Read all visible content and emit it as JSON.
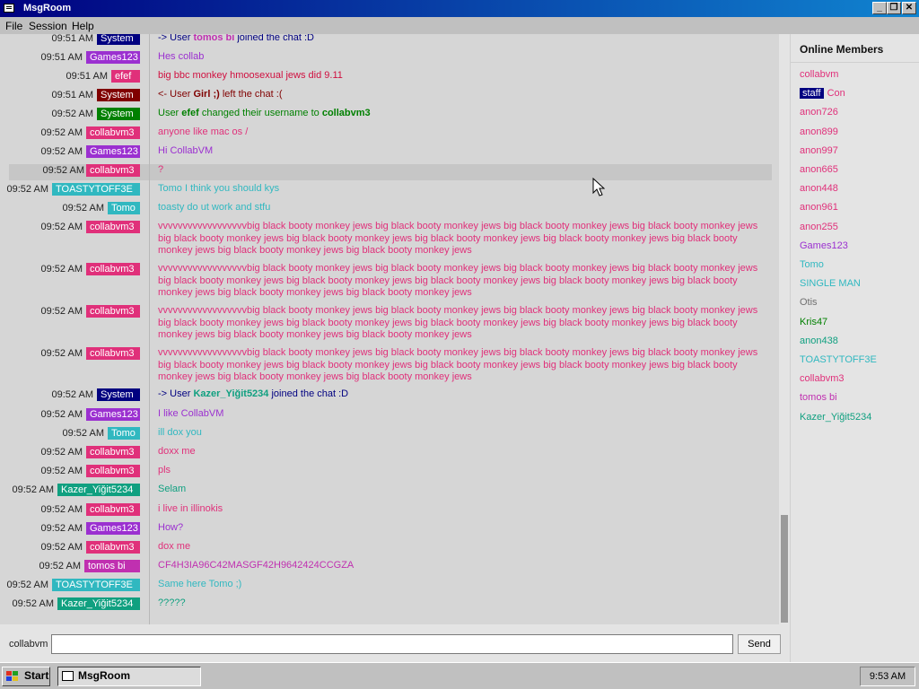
{
  "window": {
    "title": "MsgRoom"
  },
  "menu": [
    "File",
    "Session",
    "Help"
  ],
  "colors": {
    "system_blue": "#000080",
    "system_red": "#800000",
    "system_green": "#008000",
    "games": "#9b30d0",
    "collab": "#e0307a",
    "efef": "#e0307a",
    "toasty": "#30b8c0",
    "tomo": "#30b8c0",
    "kazer": "#10a080",
    "tomos": "#c030b0"
  },
  "messages": [
    {
      "time": "09:51 AM",
      "user": "System",
      "ucolor": "#000080",
      "tcolor": "#000080",
      "pre": "-> User ",
      "bold": "tomos bi",
      "post": " joined the chat :D"
    },
    {
      "time": "09:51 AM",
      "user": "Games123",
      "ucolor": "#9b30d0",
      "tcolor": "#9b30d0",
      "pre": "Hes collab",
      "bold": "",
      "post": ""
    },
    {
      "time": "09:51 AM",
      "user": "efef",
      "ucolor": "#e0307a",
      "tcolor": "#d01040",
      "pre": "big bbc monkey hmoosexual jews did 9.11",
      "bold": "",
      "post": ""
    },
    {
      "time": "09:51 AM",
      "user": "System",
      "ucolor": "#800000",
      "tcolor": "#800000",
      "pre": "<- User ",
      "bold": "Girl ;)",
      "post": " left the chat :("
    },
    {
      "time": "09:52 AM",
      "user": "System",
      "ucolor": "#008000",
      "tcolor": "#008000",
      "pre": "User ",
      "bold": "efef",
      "post": " changed their username to ",
      "bold2": "collabvm3"
    },
    {
      "time": "09:52 AM",
      "user": "collabvm3",
      "ucolor": "#e0307a",
      "tcolor": "#e0307a",
      "pre": "anyone like mac os /",
      "bold": "",
      "post": ""
    },
    {
      "time": "09:52 AM",
      "user": "Games123",
      "ucolor": "#9b30d0",
      "tcolor": "#9b30d0",
      "pre": "Hi CollabVM",
      "bold": "",
      "post": ""
    },
    {
      "time": "09:52 AM",
      "user": "collabvm3",
      "ucolor": "#e0307a",
      "tcolor": "#e0307a",
      "pre": "?",
      "bold": "",
      "post": "",
      "hl": true
    },
    {
      "time": "09:52 AM",
      "user": "TOASTYTOFF3E",
      "ucolor": "#30b8c0",
      "tcolor": "#30b8c0",
      "pre": "Tomo I think you should kys",
      "bold": "",
      "post": ""
    },
    {
      "time": "09:52 AM",
      "user": "Tomo",
      "ucolor": "#30b8c0",
      "tcolor": "#30b8c0",
      "pre": "toasty do ut work and stfu",
      "bold": "",
      "post": ""
    },
    {
      "time": "09:52 AM",
      "user": "collabvm3",
      "ucolor": "#e0307a",
      "tcolor": "#e0307a",
      "pre": "vvvvvvvvvvvvvvvvvvbig black booty monkey jews big black booty monkey jews big black booty monkey jews big black booty monkey jews big black booty monkey jews big black booty monkey jews big black booty monkey jews big black booty monkey jews big black booty monkey jews big black booty monkey jews big black booty monkey jews",
      "bold": "",
      "post": ""
    },
    {
      "time": "09:52 AM",
      "user": "collabvm3",
      "ucolor": "#e0307a",
      "tcolor": "#e0307a",
      "pre": "vvvvvvvvvvvvvvvvvvbig black booty monkey jews big black booty monkey jews big black booty monkey jews big black booty monkey jews big black booty monkey jews big black booty monkey jews big black booty monkey jews big black booty monkey jews big black booty monkey jews big black booty monkey jews big black booty monkey jews",
      "bold": "",
      "post": ""
    },
    {
      "time": "09:52 AM",
      "user": "collabvm3",
      "ucolor": "#e0307a",
      "tcolor": "#e0307a",
      "pre": "vvvvvvvvvvvvvvvvvvbig black booty monkey jews big black booty monkey jews big black booty monkey jews big black booty monkey jews big black booty monkey jews big black booty monkey jews big black booty monkey jews big black booty monkey jews big black booty monkey jews big black booty monkey jews big black booty monkey jews",
      "bold": "",
      "post": ""
    },
    {
      "time": "09:52 AM",
      "user": "collabvm3",
      "ucolor": "#e0307a",
      "tcolor": "#e0307a",
      "pre": "vvvvvvvvvvvvvvvvvvbig black booty monkey jews big black booty monkey jews big black booty monkey jews big black booty monkey jews big black booty monkey jews big black booty monkey jews big black booty monkey jews big black booty monkey jews big black booty monkey jews big black booty monkey jews big black booty monkey jews",
      "bold": "",
      "post": ""
    },
    {
      "time": "09:52 AM",
      "user": "System",
      "ucolor": "#000080",
      "tcolor": "#000080",
      "pre": "-> User ",
      "bold": "Kazer_Yiğit5234",
      "post": " joined the chat :D",
      "boldcolor": "#10a080"
    },
    {
      "time": "09:52 AM",
      "user": "Games123",
      "ucolor": "#9b30d0",
      "tcolor": "#9b30d0",
      "pre": "I like CollabVM",
      "bold": "",
      "post": ""
    },
    {
      "time": "09:52 AM",
      "user": "Tomo",
      "ucolor": "#30b8c0",
      "tcolor": "#30b8c0",
      "pre": "ill dox you",
      "bold": "",
      "post": ""
    },
    {
      "time": "09:52 AM",
      "user": "collabvm3",
      "ucolor": "#e0307a",
      "tcolor": "#e0307a",
      "pre": "doxx me",
      "bold": "",
      "post": ""
    },
    {
      "time": "09:52 AM",
      "user": "collabvm3",
      "ucolor": "#e0307a",
      "tcolor": "#e0307a",
      "pre": "pls",
      "bold": "",
      "post": ""
    },
    {
      "time": "09:52 AM",
      "user": "Kazer_Yiğit5234",
      "ucolor": "#10a080",
      "tcolor": "#10a080",
      "pre": "Selam",
      "bold": "",
      "post": ""
    },
    {
      "time": "09:52 AM",
      "user": "collabvm3",
      "ucolor": "#e0307a",
      "tcolor": "#e0307a",
      "pre": "i live in illinokis",
      "bold": "",
      "post": ""
    },
    {
      "time": "09:52 AM",
      "user": "Games123",
      "ucolor": "#9b30d0",
      "tcolor": "#9b30d0",
      "pre": "How?",
      "bold": "",
      "post": ""
    },
    {
      "time": "09:52 AM",
      "user": "collabvm3",
      "ucolor": "#e0307a",
      "tcolor": "#e0307a",
      "pre": "dox me",
      "bold": "",
      "post": ""
    },
    {
      "time": "09:52 AM",
      "user": "tomos bi",
      "ucolor": "#c030b0",
      "tcolor": "#c030b0",
      "pre": "CF4H3IA96C42MASGF42H9642424CCGZA",
      "bold": "",
      "post": ""
    },
    {
      "time": "09:52 AM",
      "user": "TOASTYTOFF3E",
      "ucolor": "#30b8c0",
      "tcolor": "#30b8c0",
      "pre": "Same here Tomo ;)",
      "bold": "",
      "post": ""
    },
    {
      "time": "09:52 AM",
      "user": "Kazer_Yiğit5234",
      "ucolor": "#10a080",
      "tcolor": "#10a080",
      "pre": "?????",
      "bold": "",
      "post": ""
    }
  ],
  "members": {
    "title": "Online Members",
    "list": [
      {
        "name": "collabvm",
        "color": "#e0307a"
      },
      {
        "name": "Con",
        "color": "#e0307a",
        "badge": "staff"
      },
      {
        "name": "anon726",
        "color": "#e0307a"
      },
      {
        "name": "anon899",
        "color": "#e0307a"
      },
      {
        "name": "anon997",
        "color": "#e0307a"
      },
      {
        "name": "anon665",
        "color": "#e0307a"
      },
      {
        "name": "anon448",
        "color": "#e0307a"
      },
      {
        "name": "anon961",
        "color": "#e0307a"
      },
      {
        "name": "anon255",
        "color": "#e0307a"
      },
      {
        "name": "Games123",
        "color": "#9b30d0"
      },
      {
        "name": "Tomo",
        "color": "#30b8c0"
      },
      {
        "name": "SINGLE MAN",
        "color": "#30b8c0"
      },
      {
        "name": "Otis",
        "color": "#707070"
      },
      {
        "name": "Kris47",
        "color": "#008000"
      },
      {
        "name": "anon438",
        "color": "#10a080"
      },
      {
        "name": "TOASTYTOFF3E",
        "color": "#30b8c0"
      },
      {
        "name": "collabvm3",
        "color": "#e0307a"
      },
      {
        "name": "tomos bi",
        "color": "#c030b0"
      },
      {
        "name": "Kazer_Yiğit5234",
        "color": "#10a080"
      }
    ]
  },
  "composer": {
    "username": "collabvm",
    "value": "",
    "send_label": "Send"
  },
  "taskbar": {
    "start_label": "Start",
    "app_label": "MsgRoom",
    "clock": "9:53 AM"
  }
}
